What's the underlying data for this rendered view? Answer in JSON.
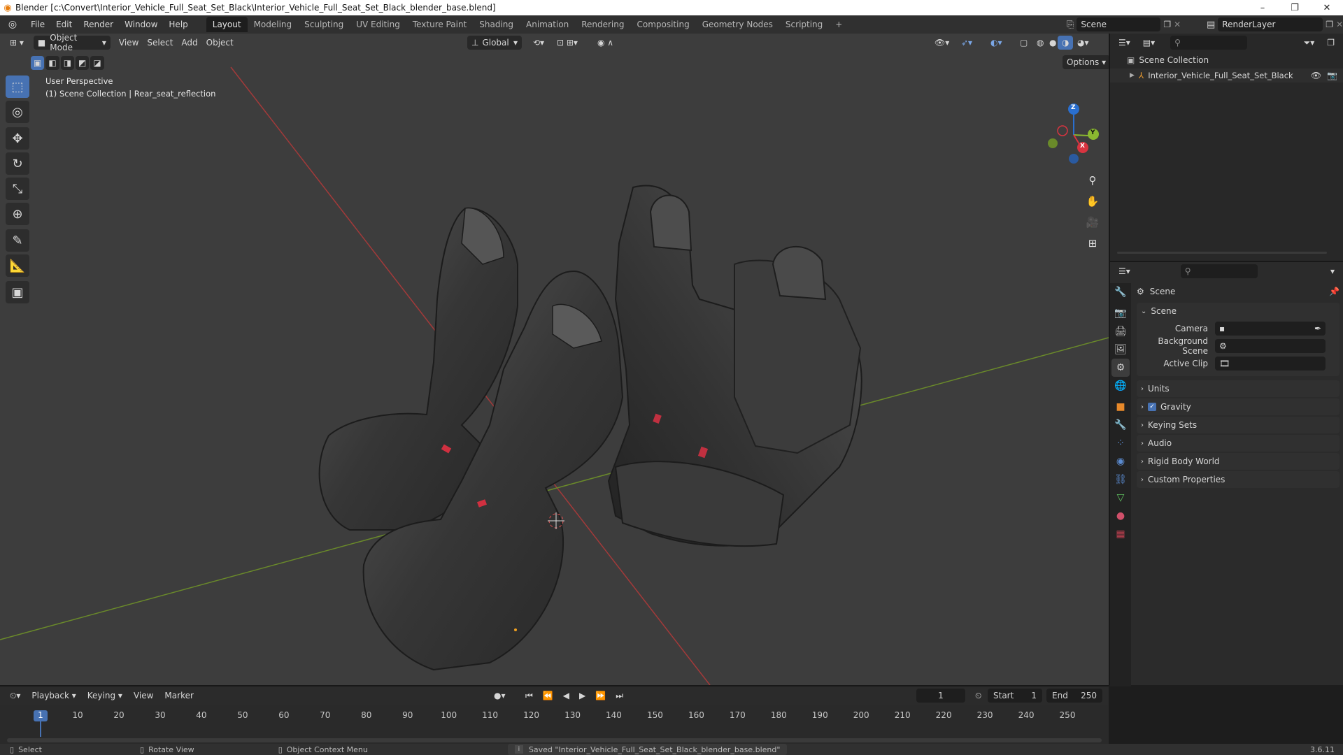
{
  "window": {
    "title": "Blender [c:\\Convert\\Interior_Vehicle_Full_Seat_Set_Black\\Interior_Vehicle_Full_Seat_Set_Black_blender_base.blend]",
    "minimize": "–",
    "maximize": "❐",
    "close": "✕"
  },
  "menu": [
    "File",
    "Edit",
    "Render",
    "Window",
    "Help"
  ],
  "workspaces": [
    "Layout",
    "Modeling",
    "Sculpting",
    "UV Editing",
    "Texture Paint",
    "Shading",
    "Animation",
    "Rendering",
    "Compositing",
    "Geometry Nodes",
    "Scripting"
  ],
  "workspace_add": "+",
  "scene_name": "Scene",
  "view_layer": "RenderLayer",
  "viewport": {
    "mode": "Object Mode",
    "menus": [
      "View",
      "Select",
      "Add",
      "Object"
    ],
    "orientation": "Global",
    "options_label": "Options",
    "overlay_line1": "User Perspective",
    "overlay_line2": "(1) Scene Collection | Rear_seat_reflection",
    "gizmo_axes": [
      "X",
      "Y",
      "Z"
    ]
  },
  "tools": [
    "select-box",
    "cursor",
    "move",
    "rotate",
    "scale",
    "transform",
    "annotate",
    "measure",
    "add-cube"
  ],
  "outliner": {
    "root": "Scene Collection",
    "items": [
      {
        "label": "Interior_Vehicle_Full_Seat_Set_Black"
      }
    ]
  },
  "properties": {
    "header": "Scene",
    "panel_title": "Scene",
    "fields": [
      {
        "label": "Camera",
        "value": ""
      },
      {
        "label": "Background Scene",
        "value": ""
      },
      {
        "label": "Active Clip",
        "value": ""
      }
    ],
    "sections": [
      "Units",
      "Gravity",
      "Keying Sets",
      "Audio",
      "Rigid Body World",
      "Custom Properties"
    ],
    "gravity_checked": true
  },
  "timeline": {
    "menus": [
      "Playback",
      "Keying",
      "View",
      "Marker"
    ],
    "current_frame": "1",
    "start_label": "Start",
    "start": "1",
    "end_label": "End",
    "end": "250",
    "ticks": [
      "1",
      "10",
      "20",
      "30",
      "40",
      "50",
      "60",
      "70",
      "80",
      "90",
      "100",
      "110",
      "120",
      "130",
      "140",
      "150",
      "160",
      "170",
      "180",
      "190",
      "200",
      "210",
      "220",
      "230",
      "240",
      "250"
    ]
  },
  "statusbar": {
    "select": "Select",
    "rotate": "Rotate View",
    "context": "Object Context Menu",
    "message": "Saved \"Interior_Vehicle_Full_Seat_Set_Black_blender_base.blend\"",
    "version": "3.6.11"
  }
}
